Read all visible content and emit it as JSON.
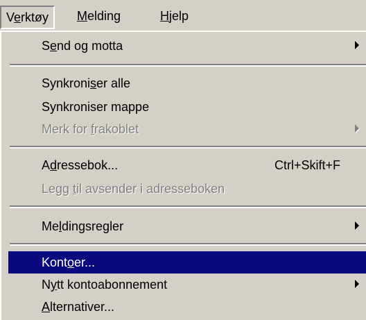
{
  "menubar": {
    "items": [
      {
        "pre": "V",
        "ul": "e",
        "post": "rktøy"
      },
      {
        "pre": "",
        "ul": "M",
        "post": "elding"
      },
      {
        "pre": "",
        "ul": "H",
        "post": "jelp"
      }
    ]
  },
  "menu": {
    "send_receive": {
      "pre": "S",
      "ul": "e",
      "post": "nd og motta"
    },
    "sync_all": {
      "pre": "Synkroni",
      "ul": "s",
      "post": "er alle"
    },
    "sync_folder": {
      "pre": "Synkroniser mappe",
      "ul": "",
      "post": ""
    },
    "mark_offline": {
      "pre": "Merk for ",
      "ul": "f",
      "post": "rakoblet"
    },
    "address_book": {
      "pre": "A",
      "ul": "d",
      "post": "ressebok..."
    },
    "address_book_shortcut": "Ctrl+Skift+F",
    "add_sender": {
      "pre": "Legg ",
      "ul": "t",
      "post": "il avsender i adresseboken"
    },
    "message_rules": {
      "pre": "Me",
      "ul": "l",
      "post": "dingsregler"
    },
    "accounts": {
      "pre": "Kont",
      "ul": "o",
      "post": "er..."
    },
    "new_subscription": {
      "pre": "N",
      "ul": "y",
      "post": "tt kontoabonnement"
    },
    "options": {
      "pre": "",
      "ul": "A",
      "post": "lternativer..."
    }
  }
}
